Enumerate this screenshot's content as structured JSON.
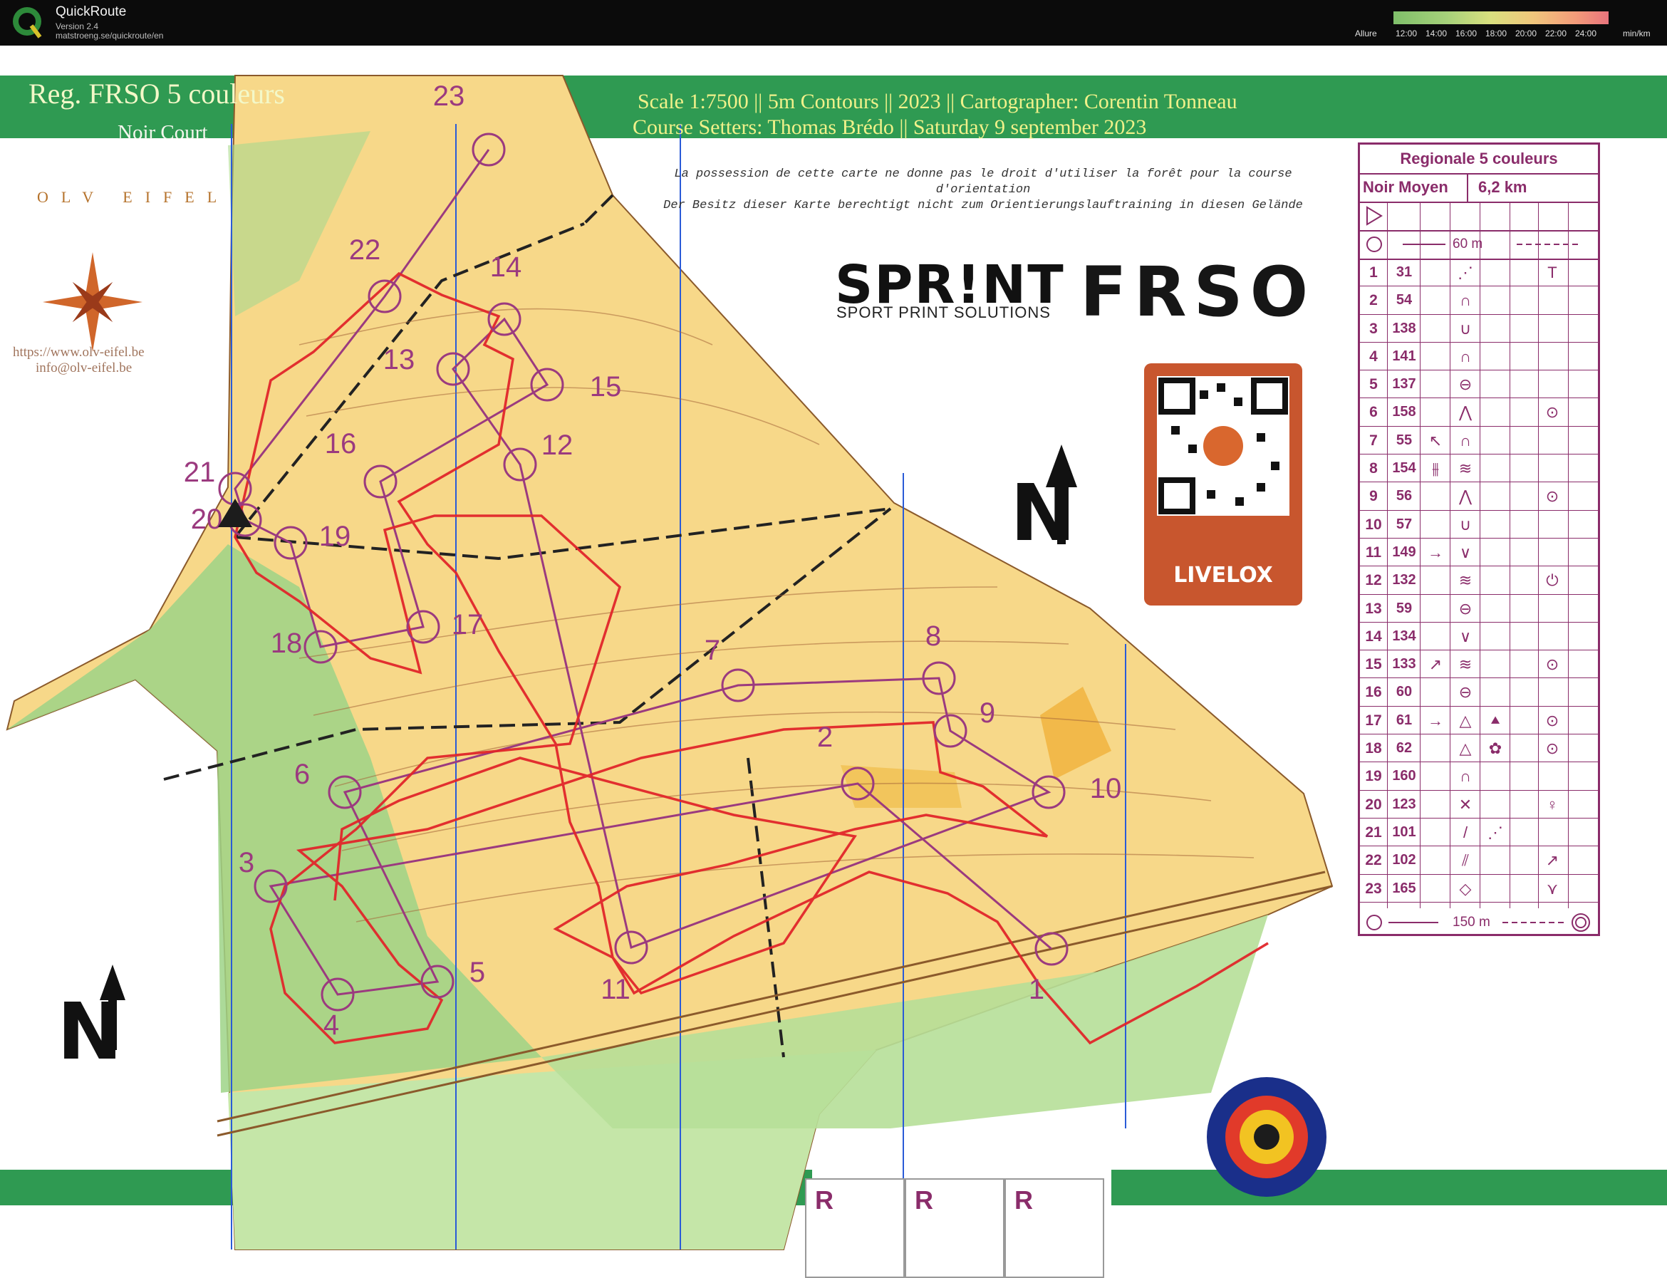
{
  "app": {
    "name": "QuickRoute",
    "version": "Version 2.4",
    "url": "matstroeng.se/quickroute/en",
    "legend_label": "Allure",
    "legend_ticks": [
      "12:00",
      "14:00",
      "16:00",
      "18:00",
      "20:00",
      "22:00",
      "24:00"
    ],
    "legend_unit": "min/km"
  },
  "map": {
    "title": "Reg. FRSO 5 couleurs",
    "course": "Noir Court",
    "scale_line": "Scale 1:7500 || 5m Contours || 2023 || Cartographer: Corentin Tonneau",
    "setters_line": "Course Setters: Thomas Brédo || Saturday 9 september 2023",
    "notice_fr": "La possession de cette carte ne donne pas le droit d'utiliser la forêt pour la course d'orientation",
    "notice_de": "Der Besitz dieser Karte berechtigt nicht zum Orientierungslauftraining in diesen Gelände",
    "club_letters": "OLV EIFEL",
    "club_url": "https://www.olv-eifel.be",
    "club_mail": "info@olv-eifel.be",
    "sponsor_name": "SPR!NT",
    "sponsor_sub": "SPORT PRINT SOLUTIONS",
    "federation": "FRSO",
    "livelox_label": "LIVELOX",
    "north_label": "N",
    "r_boxes": [
      "R",
      "R",
      "R"
    ],
    "colors": {
      "forest_open": "#f7d889",
      "forest_green": "#7cc36b",
      "light_green": "#c5e6a8",
      "route": "#e0262a",
      "course": "#9b3a7f",
      "header_green": "#2f9a52"
    }
  },
  "controls": [
    {
      "label": "1"
    },
    {
      "label": "2"
    },
    {
      "label": "3"
    },
    {
      "label": "4"
    },
    {
      "label": "5"
    },
    {
      "label": "6"
    },
    {
      "label": "7"
    },
    {
      "label": "8"
    },
    {
      "label": "9"
    },
    {
      "label": "10"
    },
    {
      "label": "11"
    },
    {
      "label": "12"
    },
    {
      "label": "13"
    },
    {
      "label": "14"
    },
    {
      "label": "15"
    },
    {
      "label": "16"
    },
    {
      "label": "17"
    },
    {
      "label": "18"
    },
    {
      "label": "19"
    },
    {
      "label": "20"
    },
    {
      "label": "21"
    },
    {
      "label": "22"
    },
    {
      "label": "23"
    }
  ],
  "description": {
    "title": "Regionale 5 couleurs",
    "course": "Noir Moyen",
    "length": "6,2 km",
    "start_distance": "60 m",
    "finish_distance": "150 m",
    "rows": [
      {
        "n": "1",
        "code": "31",
        "s1": "",
        "s2": "⋰",
        "s3": "",
        "s4": "T"
      },
      {
        "n": "2",
        "code": "54",
        "s1": "",
        "s2": "∩",
        "s3": "",
        "s4": ""
      },
      {
        "n": "3",
        "code": "138",
        "s1": "",
        "s2": "∪",
        "s3": "",
        "s4": ""
      },
      {
        "n": "4",
        "code": "141",
        "s1": "",
        "s2": "∩",
        "s3": "",
        "s4": ""
      },
      {
        "n": "5",
        "code": "137",
        "s1": "",
        "s2": "⊖",
        "s3": "",
        "s4": ""
      },
      {
        "n": "6",
        "code": "158",
        "s1": "",
        "s2": "⋀",
        "s3": "",
        "s4": "⊙"
      },
      {
        "n": "7",
        "code": "55",
        "s1": "↖",
        "s2": "∩",
        "s3": "",
        "s4": ""
      },
      {
        "n": "8",
        "code": "154",
        "s1": "⫵",
        "s2": "≋",
        "s3": "",
        "s4": ""
      },
      {
        "n": "9",
        "code": "56",
        "s1": "",
        "s2": "⋀",
        "s3": "",
        "s4": "⊙"
      },
      {
        "n": "10",
        "code": "57",
        "s1": "",
        "s2": "∪",
        "s3": "",
        "s4": ""
      },
      {
        "n": "11",
        "code": "149",
        "s1": "→",
        "s2": "∨",
        "s3": "",
        "s4": ""
      },
      {
        "n": "12",
        "code": "132",
        "s1": "",
        "s2": "≋",
        "s3": "",
        "s4": "⏻"
      },
      {
        "n": "13",
        "code": "59",
        "s1": "",
        "s2": "⊖",
        "s3": "",
        "s4": ""
      },
      {
        "n": "14",
        "code": "134",
        "s1": "",
        "s2": "∨",
        "s3": "",
        "s4": ""
      },
      {
        "n": "15",
        "code": "133",
        "s1": "↗",
        "s2": "≋",
        "s3": "",
        "s4": "⊙"
      },
      {
        "n": "16",
        "code": "60",
        "s1": "",
        "s2": "⊖",
        "s3": "",
        "s4": ""
      },
      {
        "n": "17",
        "code": "61",
        "s1": "→",
        "s2": "△",
        "s3": "⯅",
        "s4": "⊙"
      },
      {
        "n": "18",
        "code": "62",
        "s1": "",
        "s2": "△",
        "s3": "✿",
        "s4": "⊙"
      },
      {
        "n": "19",
        "code": "160",
        "s1": "",
        "s2": "∩",
        "s3": "",
        "s4": ""
      },
      {
        "n": "20",
        "code": "123",
        "s1": "",
        "s2": "✕",
        "s3": "",
        "s4": "♀"
      },
      {
        "n": "21",
        "code": "101",
        "s1": "",
        "s2": "/",
        "s3": "⋰",
        "s4": ""
      },
      {
        "n": "22",
        "code": "102",
        "s1": "",
        "s2": "⫽",
        "s3": "",
        "s4": "↗"
      },
      {
        "n": "23",
        "code": "165",
        "s1": "",
        "s2": "◇",
        "s3": "",
        "s4": "⋎"
      }
    ]
  }
}
